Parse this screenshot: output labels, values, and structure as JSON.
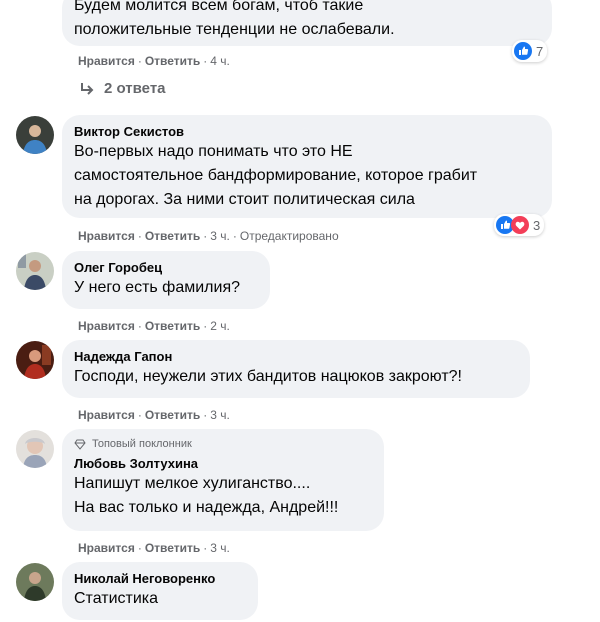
{
  "comments": [
    {
      "lines": [
        "Будем молится всем богам, чтоб такие",
        "положительные тенденции не ослабевали."
      ],
      "actions": {
        "like": "Нравится",
        "reply": "Ответить",
        "time": "4 ч."
      },
      "reactions_count": "7",
      "replies_label": "2 ответа"
    },
    {
      "author": "Виктор Секистов",
      "lines": [
        "Во-первых надо понимать что это НЕ",
        "самостоятельное бандформирование, которое грабит",
        "на дорогах. За ними стоит политическая сила"
      ],
      "actions": {
        "like": "Нравится",
        "reply": "Ответить",
        "time": "3 ч.",
        "edited": "Отредактировано"
      },
      "reactions_count": "3"
    },
    {
      "author": "Олег Горобец",
      "lines": [
        "У него есть фамилия?"
      ],
      "actions": {
        "like": "Нравится",
        "reply": "Ответить",
        "time": "2 ч."
      }
    },
    {
      "author": "Надежда Гапон",
      "lines": [
        "Господи, неужели этих бандитов нацюков закроют?!"
      ],
      "actions": {
        "like": "Нравится",
        "reply": "Ответить",
        "time": "3 ч."
      }
    },
    {
      "badge": "Топовый поклонник",
      "author": "Любовь Золтухина",
      "lines": [
        "Напишут мелкое хулиганство....",
        "На вас только и надежда, Андрей!!!"
      ],
      "actions": {
        "like": "Нравится",
        "reply": "Ответить",
        "time": "3 ч."
      }
    },
    {
      "author": "Николай Неговоренко",
      "lines": [
        "Статистика"
      ]
    }
  ],
  "separator": "·",
  "colors": {
    "bubble": "#f0f2f5",
    "meta": "#65676b",
    "like_blue": "#1877f2",
    "love_red": "#f33e58"
  },
  "icons": {
    "like": "thumbs-up-icon",
    "love": "heart-icon",
    "reply_arrow": "reply-arrow-icon",
    "badge": "diamond-icon"
  }
}
